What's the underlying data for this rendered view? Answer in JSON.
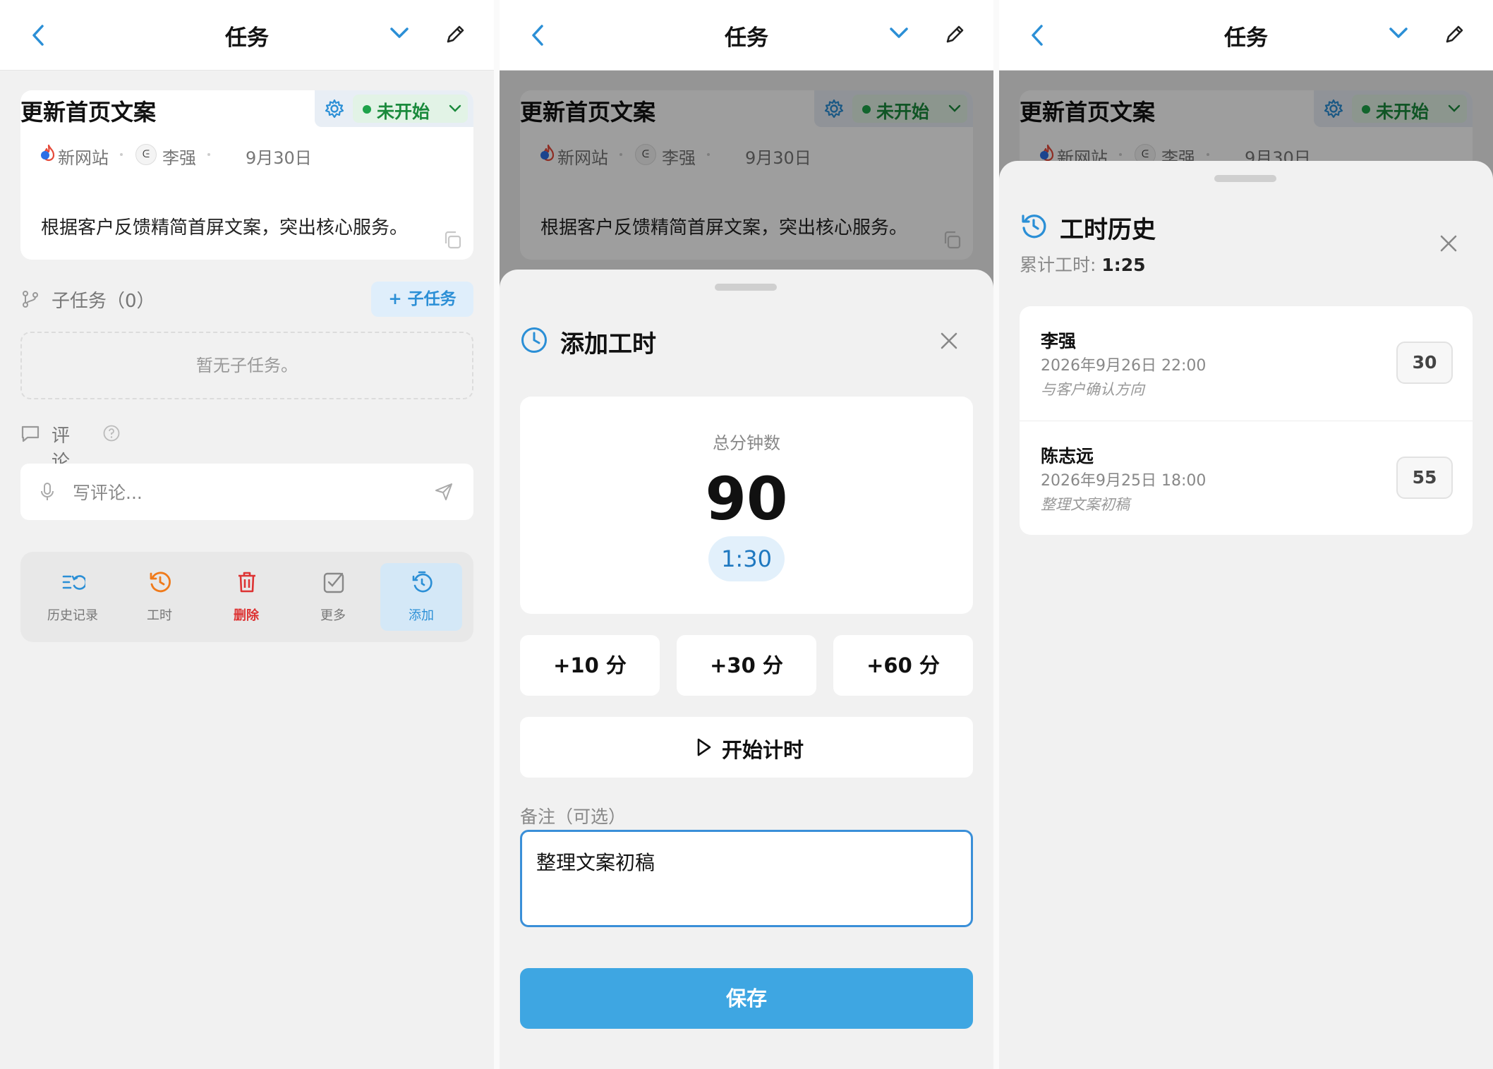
{
  "nav": {
    "title": "任务"
  },
  "task": {
    "title": "更新首页文案",
    "status": "未开始",
    "project": "新网站",
    "assignee": "李强",
    "avatar_glyph": "ᕮ",
    "due": "9月30日",
    "description": "根据客户反馈精简首屏文案，突出核心服务。"
  },
  "subtasks": {
    "header": "子任务（0）",
    "add_label": "+ 子任务",
    "empty": "暂无子任务。"
  },
  "comments": {
    "header": "评论",
    "placeholder": "写评论..."
  },
  "actions": [
    {
      "label": "历史记录",
      "icon": "history-list-icon"
    },
    {
      "label": "工时",
      "icon": "clock-history-icon"
    },
    {
      "label": "删除",
      "icon": "trash-icon"
    },
    {
      "label": "更多",
      "icon": "checkbox-icon"
    },
    {
      "label": "添加",
      "icon": "timer-add-icon"
    }
  ],
  "add_time": {
    "title": "添加工时",
    "total_label": "总分钟数",
    "total_minutes": "90",
    "formatted": "1:30",
    "quick": [
      "+10 分",
      "+30 分",
      "+60 分"
    ],
    "timer_label": "开始计时",
    "note_label": "备注（可选）",
    "note_value": "整理文案初稿",
    "save_label": "保存"
  },
  "history": {
    "title": "工时历史",
    "total_label": "累计工时:",
    "total_value": "1:25",
    "entries": [
      {
        "name": "李强",
        "datetime": "2026年9月26日 22:00",
        "note": "与客户确认方向",
        "minutes": "30"
      },
      {
        "name": "陈志远",
        "datetime": "2026年9月25日 18:00",
        "note": "整理文案初稿",
        "minutes": "55"
      }
    ]
  },
  "colors": {
    "accent": "#3ea6e2",
    "status_green": "#1ea34a",
    "danger": "#d33333",
    "orange": "#f07a1a"
  }
}
